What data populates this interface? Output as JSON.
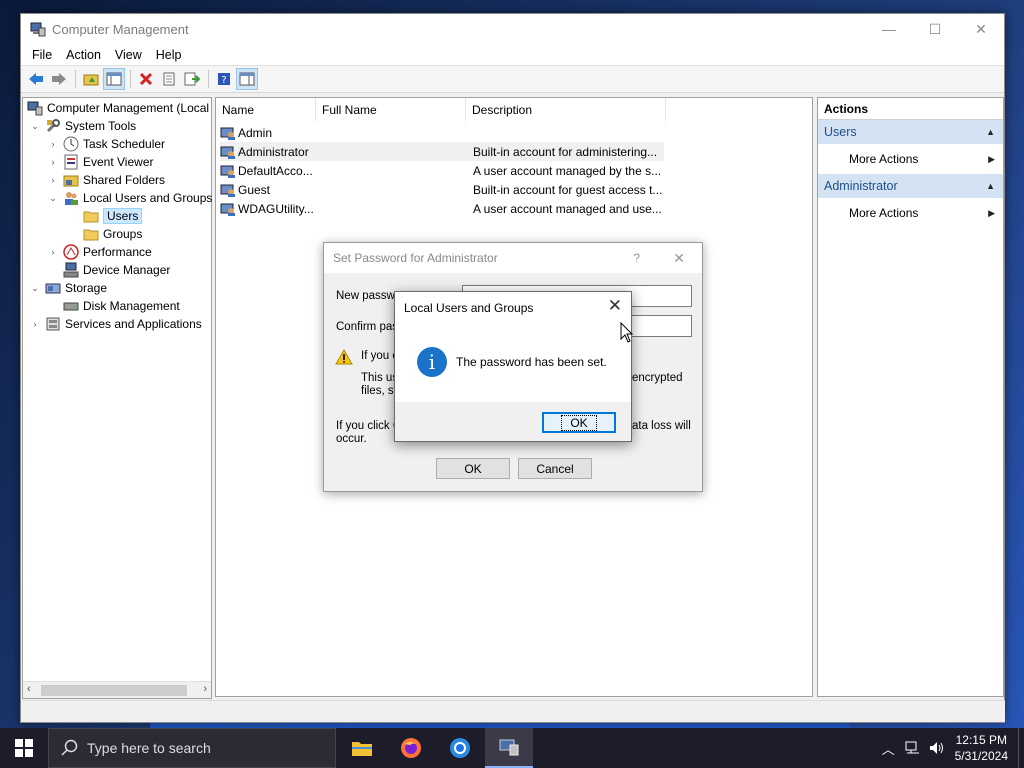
{
  "window": {
    "title": "Computer Management",
    "controls": {
      "minimize": "—",
      "maximize": "☐",
      "close": "✕"
    }
  },
  "menu": [
    "File",
    "Action",
    "View",
    "Help"
  ],
  "tree": {
    "items": [
      {
        "label": "Computer Management (Local",
        "icon": "computer-management-icon",
        "arrow": ""
      },
      {
        "label": "System Tools",
        "icon": "system-tools-icon",
        "arrow": "⌄"
      },
      {
        "label": "Task Scheduler",
        "icon": "clock-icon",
        "arrow": "›"
      },
      {
        "label": "Event Viewer",
        "icon": "event-viewer-icon",
        "arrow": "›"
      },
      {
        "label": "Shared Folders",
        "icon": "shared-folders-icon",
        "arrow": "›"
      },
      {
        "label": "Local Users and Groups",
        "icon": "users-groups-icon",
        "arrow": "⌄"
      },
      {
        "label": "Users",
        "icon": "folder-icon",
        "arrow": ""
      },
      {
        "label": "Groups",
        "icon": "folder-icon",
        "arrow": ""
      },
      {
        "label": "Performance",
        "icon": "performance-icon",
        "arrow": "›"
      },
      {
        "label": "Device Manager",
        "icon": "device-manager-icon",
        "arrow": ""
      },
      {
        "label": "Storage",
        "icon": "storage-icon",
        "arrow": "⌄"
      },
      {
        "label": "Disk Management",
        "icon": "disk-icon",
        "arrow": ""
      },
      {
        "label": "Services and Applications",
        "icon": "services-icon",
        "arrow": "›"
      }
    ]
  },
  "list": {
    "columns": [
      "Name",
      "Full Name",
      "Description"
    ],
    "rows": [
      {
        "name": "Admin",
        "full_name": "",
        "description": ""
      },
      {
        "name": "Administrator",
        "full_name": "",
        "description": "Built-in account for administering..."
      },
      {
        "name": "DefaultAcco...",
        "full_name": "",
        "description": "A user account managed by the s..."
      },
      {
        "name": "Guest",
        "full_name": "",
        "description": "Built-in account for guest access t..."
      },
      {
        "name": "WDAGUtility...",
        "full_name": "",
        "description": "A user account managed and use..."
      }
    ]
  },
  "actions": {
    "header": "Actions",
    "groups": [
      {
        "title": "Users",
        "items": [
          "More Actions"
        ]
      },
      {
        "title": "Administrator",
        "items": [
          "More Actions"
        ]
      }
    ]
  },
  "set_password_dialog": {
    "title": "Set Password for Administrator",
    "help": "?",
    "close": "✕",
    "new_password_label": "New passwo",
    "confirm_password_label": "Confirm pass",
    "warning_line1": "If you c",
    "warning_line2a": "This us",
    "warning_line2b": "encrypted",
    "warning_line3": "files, st",
    "bottom_line1a": "If you click C",
    "bottom_line1b": "ata loss will",
    "bottom_line2": "occur.",
    "ok": "OK",
    "cancel": "Cancel"
  },
  "message_box": {
    "title": "Local Users and Groups",
    "close": "✕",
    "icon_glyph": "i",
    "message": "The password has been set.",
    "ok": "OK"
  },
  "taskbar": {
    "search_placeholder": "Type here to search",
    "time": "12:15 PM",
    "date": "5/31/2024"
  }
}
